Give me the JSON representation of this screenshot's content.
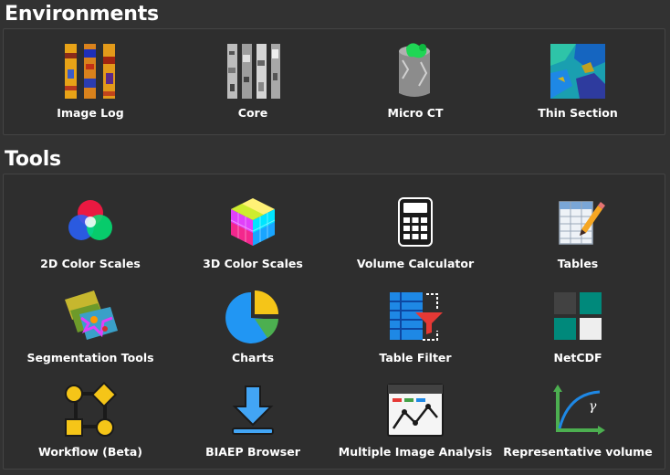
{
  "environments": {
    "title": "Environments",
    "items": [
      {
        "label": "Image Log",
        "icon": "image-log-icon"
      },
      {
        "label": "Core",
        "icon": "core-icon"
      },
      {
        "label": "Micro CT",
        "icon": "micro-ct-icon"
      },
      {
        "label": "Thin Section",
        "icon": "thin-section-icon"
      }
    ]
  },
  "tools": {
    "title": "Tools",
    "items": [
      {
        "label": "2D Color Scales",
        "icon": "rgb-circles-icon"
      },
      {
        "label": "3D Color Scales",
        "icon": "color-cube-icon"
      },
      {
        "label": "Volume Calculator",
        "icon": "calculator-icon"
      },
      {
        "label": "Tables",
        "icon": "table-pencil-icon"
      },
      {
        "label": "Segmentation Tools",
        "icon": "segmentation-icon"
      },
      {
        "label": "Charts",
        "icon": "pie-chart-icon"
      },
      {
        "label": "Table Filter",
        "icon": "table-filter-icon"
      },
      {
        "label": "NetCDF",
        "icon": "netcdf-grid-icon"
      },
      {
        "label": "Workflow (Beta)",
        "icon": "workflow-icon"
      },
      {
        "label": "BIAEP Browser",
        "icon": "download-icon"
      },
      {
        "label": "Multiple Image Analysis",
        "icon": "multi-image-analysis-icon"
      },
      {
        "label": "Representative volume",
        "icon": "representative-volume-icon"
      }
    ]
  },
  "colors": {
    "background": "#323232",
    "panel_border": "#444444",
    "text": "#ffffff",
    "accent_yellow": "#f5c518",
    "accent_blue": "#2196f3",
    "accent_green": "#4caf50",
    "accent_teal": "#00897b",
    "accent_red": "#e53935"
  }
}
